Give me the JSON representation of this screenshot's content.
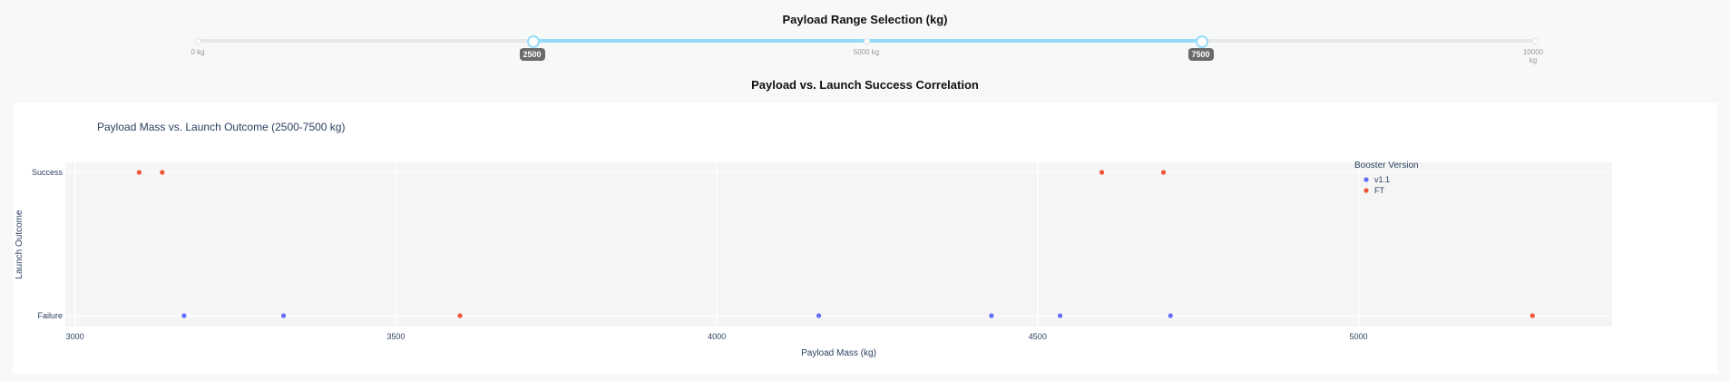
{
  "range_slider": {
    "title": "Payload Range Selection (kg)",
    "min": 0,
    "max": 10000,
    "selected_low": 2500,
    "selected_high": 7500,
    "marks": [
      {
        "value": 0,
        "label": "0 kg"
      },
      {
        "value": 2500,
        "label": "2500 kg"
      },
      {
        "value": 5000,
        "label": "5000 kg"
      },
      {
        "value": 7500,
        "label": "7500 kg"
      },
      {
        "value": 10000,
        "label": "10000 kg"
      }
    ],
    "low_tooltip": "2500",
    "high_tooltip": "7500",
    "track_color": "#96dbfa"
  },
  "chart_section": {
    "heading": "Payload vs. Launch Success Correlation"
  },
  "chart_data": {
    "type": "scatter",
    "title": "Payload Mass vs. Launch Outcome (2500-7500 kg)",
    "xlabel": "Payload Mass (kg)",
    "ylabel": "Launch Outcome",
    "xlim": [
      2985,
      5395
    ],
    "x_ticks": [
      3000,
      3500,
      4000,
      4500,
      5000
    ],
    "categories_y": [
      "Failure",
      "Success"
    ],
    "grid": true,
    "legend_title": "Booster Version",
    "legend_position": "right",
    "series": [
      {
        "name": "v1.1",
        "color": "#636efa",
        "points": [
          {
            "x": 3170,
            "y": "Failure"
          },
          {
            "x": 3325,
            "y": "Failure"
          },
          {
            "x": 4159,
            "y": "Failure"
          },
          {
            "x": 4428,
            "y": "Failure"
          },
          {
            "x": 4535,
            "y": "Failure"
          },
          {
            "x": 4707,
            "y": "Failure"
          }
        ]
      },
      {
        "name": "FT",
        "color": "#ef553b",
        "points": [
          {
            "x": 3100,
            "y": "Success"
          },
          {
            "x": 3136,
            "y": "Success"
          },
          {
            "x": 4600,
            "y": "Success"
          },
          {
            "x": 4696,
            "y": "Success"
          },
          {
            "x": 3600,
            "y": "Failure"
          },
          {
            "x": 5271,
            "y": "Failure"
          }
        ]
      }
    ]
  }
}
